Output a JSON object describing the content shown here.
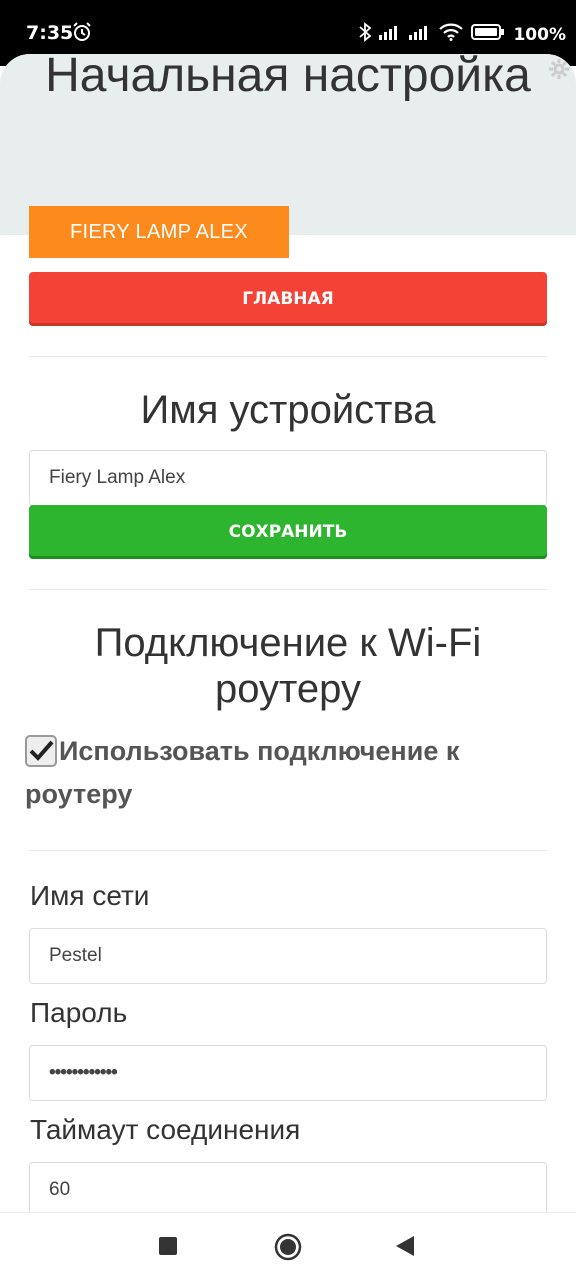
{
  "status_bar": {
    "time": "7:35",
    "battery": "100%",
    "icons": [
      "alarm-icon",
      "bluetooth-icon",
      "signal-icon",
      "signal-icon",
      "wifi-icon",
      "battery-icon"
    ]
  },
  "header": {
    "title": "Начальная настройка",
    "device_tab": "FIERY LAMP ALEX",
    "main_button": "ГЛАВНАЯ"
  },
  "device_section": {
    "title": "Имя устройства",
    "name_value": "Fiery Lamp Alex",
    "save_button": "СОХРАНИТЬ"
  },
  "wifi_section": {
    "title": "Подключение к Wi-Fi роутеру",
    "use_router_label": "Использовать подключение к роутеру",
    "use_router_checked": true,
    "network_label": "Имя сети",
    "network_value": "Pestel",
    "password_label": "Пароль",
    "password_value": "••••••••••••",
    "timeout_label": "Таймаут соединения",
    "timeout_value": "60"
  },
  "colors": {
    "accent_orange": "#fd8a1c",
    "danger_red": "#f44336",
    "success_green": "#2db52f",
    "header_bg": "#e8eeee"
  }
}
